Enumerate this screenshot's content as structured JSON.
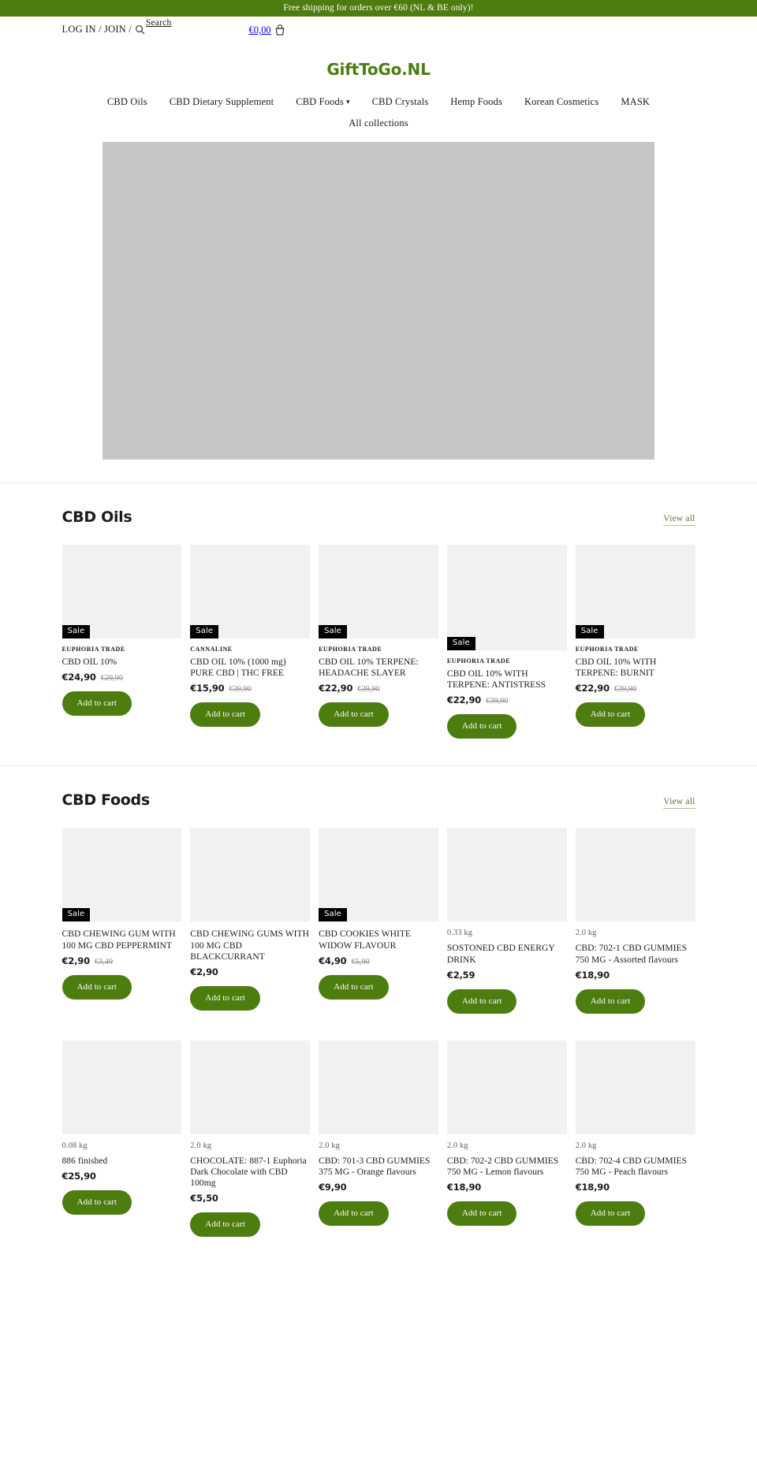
{
  "announcement": {
    "text": "Free shipping for orders over €60 (NL & BE only)!"
  },
  "header": {
    "account_label": "LOG IN / JOIN /",
    "search_label": "Search",
    "search_icon": "search-icon",
    "cart_total": "€0,00",
    "cart_icon": "shopping-cart-icon",
    "logo": "GiftToGo.NL",
    "logo_color": "#4d7c0f"
  },
  "nav": {
    "items": [
      {
        "label": "CBD Oils",
        "has_dropdown": false
      },
      {
        "label": "CBD Dietary Supplement",
        "has_dropdown": false
      },
      {
        "label": "CBD Foods",
        "has_dropdown": true,
        "caret": "⌄"
      },
      {
        "label": "CBD Crystals",
        "has_dropdown": false
      },
      {
        "label": "Hemp Foods",
        "has_dropdown": false
      },
      {
        "label": "Korean Cosmetics",
        "has_dropdown": false
      },
      {
        "label": "MASK",
        "has_dropdown": false
      }
    ],
    "secondary": {
      "label": "All collections"
    }
  },
  "hero": {
    "alt": "hero-banner-placeholder"
  },
  "sections": [
    {
      "title": "CBD Oils",
      "view_all": "View all",
      "products": [
        {
          "badge": "Sale",
          "vendor": "EUPHORIA TRADE",
          "title": "CBD OIL 10%",
          "price": "€24,90",
          "compare_at": "€29,90",
          "add_to_cart": "Add to cart"
        },
        {
          "badge": "Sale",
          "vendor": "CANNALINE",
          "title": "CBD OIL 10% (1000 mg) PURE CBD | THC FREE",
          "price": "€15,90",
          "compare_at": "€39,90",
          "add_to_cart": "Add to cart"
        },
        {
          "badge": "Sale",
          "vendor": "EUPHORIA TRADE",
          "title": "CBD OIL 10% TERPENE: HEADACHE SLAYER",
          "price": "€22,90",
          "compare_at": "€39,90",
          "add_to_cart": "Add to cart"
        },
        {
          "badge": "Sale",
          "vendor": "EUPHORIA TRADE",
          "title": "CBD OIL 10% WITH TERPENE: ANTISTRESS",
          "price": "€22,90",
          "compare_at": "€39,90",
          "add_to_cart": "Add to cart"
        },
        {
          "badge": "Sale",
          "vendor": "EUPHORIA TRADE",
          "title": "CBD OIL 10% WITH TERPENE: BURNIT",
          "price": "€22,90",
          "compare_at": "€39,90",
          "add_to_cart": "Add to cart"
        }
      ]
    },
    {
      "title": "CBD Foods",
      "view_all": "View all",
      "products": [
        {
          "badge": "Sale",
          "title": "CBD CHEWING GUM WITH 100 MG CBD PEPPERMINT",
          "price": "€2,90",
          "compare_at": "€3,49",
          "add_to_cart": "Add to cart"
        },
        {
          "badge": "",
          "title": "CBD CHEWING GUMS WITH 100 MG CBD BLACKCURRANT",
          "price": "€2,90",
          "compare_at": "",
          "add_to_cart": "Add to cart"
        },
        {
          "badge": "Sale",
          "title": "CBD COOKIES WHITE WIDOW FLAVOUR",
          "price": "€4,90",
          "compare_at": "€5,90",
          "add_to_cart": "Add to cart"
        },
        {
          "badge": "",
          "weight": "0.33 kg",
          "title": "SOSTONED CBD ENERGY DRINK",
          "price": "€2,59",
          "compare_at": "",
          "add_to_cart": "Add to cart"
        },
        {
          "badge": "",
          "weight": "2.0 kg",
          "title": "CBD: 702-1 CBD GUMMIES 750 MG - Assorted flavours",
          "price": "€18,90",
          "compare_at": "",
          "add_to_cart": "Add to cart"
        },
        {
          "badge": "",
          "weight": "0.08 kg",
          "title": "886 finished",
          "price": "€25,90",
          "compare_at": "",
          "add_to_cart": "Add to cart"
        },
        {
          "badge": "",
          "weight": "2.0 kg",
          "title": "CHOCOLATE: 887-1 Euphoria Dark Chocolate with CBD 100mg",
          "price": "€5,50",
          "compare_at": "",
          "add_to_cart": "Add to cart"
        },
        {
          "badge": "",
          "weight": "2.0 kg",
          "title": "CBD: 701-3 CBD GUMMIES 375 MG - Orange flavours",
          "price": "€9,90",
          "compare_at": "",
          "add_to_cart": "Add to cart"
        },
        {
          "badge": "",
          "weight": "2.0 kg",
          "title": "CBD: 702-2 CBD GUMMIES 750 MG - Lemon flavours",
          "price": "€18,90",
          "compare_at": "",
          "add_to_cart": "Add to cart"
        },
        {
          "badge": "",
          "weight": "2.0 kg",
          "title": "CBD: 702-4 CBD GUMMIES 750 MG - Peach flavours",
          "price": "€18,90",
          "compare_at": "",
          "add_to_cart": "Add to cart"
        }
      ]
    }
  ],
  "theme": {
    "brand_green": "#4d7c0f",
    "badge_bg": "#000000",
    "media_placeholder": "#f1f1f1",
    "hero_placeholder": "#c6c6c6"
  }
}
